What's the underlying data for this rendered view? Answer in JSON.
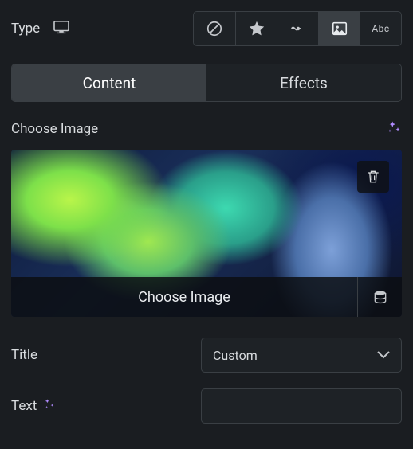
{
  "type": {
    "label": "Type",
    "options": [
      "none",
      "star",
      "freehand",
      "image",
      "text"
    ],
    "selected": "image",
    "abc_label": "Abc"
  },
  "tabs": {
    "content": "Content",
    "effects": "Effects",
    "active": "content"
  },
  "image_section": {
    "header": "Choose Image",
    "choose_label": "Choose Image"
  },
  "title_field": {
    "label": "Title",
    "selected": "Custom"
  },
  "text_field": {
    "label": "Text",
    "value": ""
  }
}
